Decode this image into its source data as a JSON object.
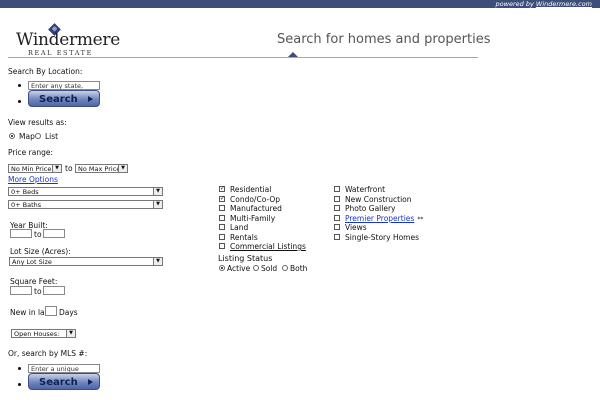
{
  "header": {
    "powered_by": "powered by",
    "powered_link": "Windermere.com",
    "logo_word": "Windermere",
    "logo_sub": "REAL ESTATE",
    "headline": "Search for homes and properties"
  },
  "location": {
    "label": "Search By Location:",
    "placeholder": "Enter any state, city,",
    "search_label": "Search"
  },
  "view": {
    "label": "View results as:",
    "options": [
      "Map",
      "List"
    ],
    "selected": "Map"
  },
  "price": {
    "label": "Price range:",
    "min": "No Min Price",
    "to": "to",
    "max": "No Max Price",
    "more_options": "More Options"
  },
  "beds": "0+ Beds",
  "baths": "0+ Baths",
  "year_built": {
    "label": "Year Built:",
    "to": "to"
  },
  "lot_size": {
    "label": "Lot Size (Acres):",
    "value": "Any Lot Size"
  },
  "square_feet": {
    "label": "Square Feet:",
    "to": "to"
  },
  "new_in_last": {
    "label": "New in last",
    "unit": "Days"
  },
  "open_houses": "Open Houses:",
  "mls": {
    "label": "Or, search by MLS #:",
    "placeholder": "Enter a unique numbe",
    "search_label": "Search"
  },
  "property_types": [
    {
      "label": "Residential",
      "checked": true
    },
    {
      "label": "Condo/Co-Op",
      "checked": true
    },
    {
      "label": "Manufactured",
      "checked": false
    },
    {
      "label": "Multi-Family",
      "checked": false
    },
    {
      "label": "Land",
      "checked": false
    },
    {
      "label": "Rentals",
      "checked": false
    },
    {
      "label": "Commercial Listings",
      "checked": false
    }
  ],
  "features": [
    {
      "label": "Waterfront",
      "checked": false
    },
    {
      "label": "New Construction",
      "checked": false
    },
    {
      "label": "Photo Gallery",
      "checked": false
    },
    {
      "label": "Premier Properties",
      "checked": false,
      "suffix": "**"
    },
    {
      "label": "Views",
      "checked": false
    },
    {
      "label": "Single-Story Homes",
      "checked": false
    }
  ],
  "listing_status": {
    "label": "Listing Status",
    "options": [
      "Active",
      "Sold",
      "Both"
    ],
    "selected": "Active"
  }
}
